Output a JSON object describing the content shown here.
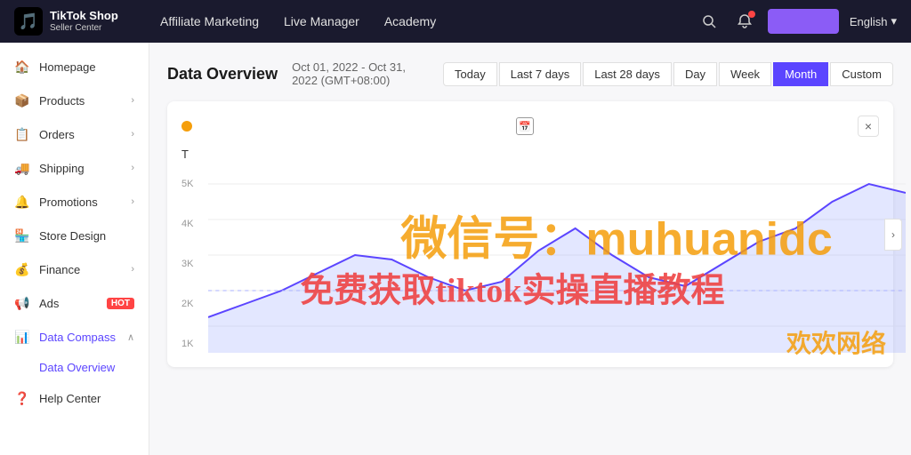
{
  "topNav": {
    "logo": {
      "icon": "🎵",
      "brand": "TikTok Shop",
      "sub": "Seller Center"
    },
    "links": [
      {
        "label": "Affiliate Marketing",
        "active": false
      },
      {
        "label": "Live Manager",
        "active": false
      },
      {
        "label": "Academy",
        "active": false
      }
    ],
    "lang": "English"
  },
  "sidebar": {
    "items": [
      {
        "label": "Homepage",
        "icon": "🏠",
        "hasChevron": false,
        "active": false
      },
      {
        "label": "Products",
        "icon": "📦",
        "hasChevron": true,
        "active": false
      },
      {
        "label": "Orders",
        "icon": "📋",
        "hasChevron": true,
        "active": false
      },
      {
        "label": "Shipping",
        "icon": "🚚",
        "hasChevron": true,
        "active": false
      },
      {
        "label": "Promotions",
        "icon": "🔔",
        "hasChevron": true,
        "active": false
      },
      {
        "label": "Store Design",
        "icon": "🏪",
        "hasChevron": false,
        "active": false
      },
      {
        "label": "Finance",
        "icon": "💰",
        "hasChevron": true,
        "active": false
      },
      {
        "label": "Ads",
        "icon": "📢",
        "hot": true,
        "hasChevron": false,
        "active": false
      },
      {
        "label": "Data Compass",
        "icon": "📊",
        "hasChevron": true,
        "active": true,
        "expanded": true
      }
    ],
    "subItems": [
      {
        "label": "Data Overview",
        "active": true
      }
    ],
    "helpCenter": "Help Center"
  },
  "content": {
    "title": "Data Overview",
    "dateRange": "Oct 01, 2022 - Oct 31, 2022 (GMT+08:00)",
    "filterButtons": [
      {
        "label": "Today",
        "active": false
      },
      {
        "label": "Last 7 days",
        "active": false
      },
      {
        "label": "Last 28 days",
        "active": false
      },
      {
        "label": "Day",
        "active": false
      },
      {
        "label": "Week",
        "active": false
      },
      {
        "label": "Month",
        "active": true
      },
      {
        "label": "Custom",
        "active": false
      }
    ],
    "chartLabel": "T",
    "yLabels": [
      "5K",
      "4K",
      "3K",
      "2K",
      "1K"
    ],
    "closeBtn": "×",
    "watermark1": "微信号：muhuanidc",
    "watermark2": "免费获取tiktok实操直播教程",
    "watermark3": "欢欢网络"
  }
}
